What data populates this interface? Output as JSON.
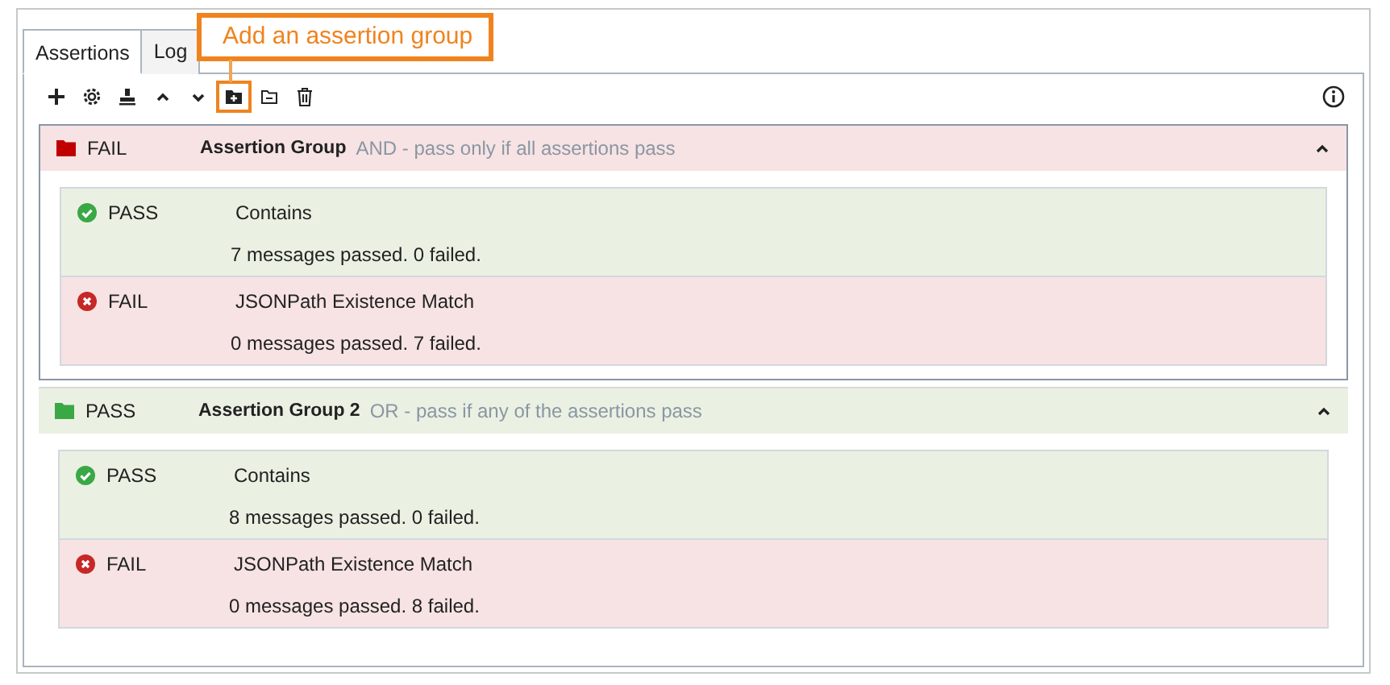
{
  "tabs": [
    {
      "label": "Assertions",
      "selected": true
    },
    {
      "label": "Log",
      "selected": false
    }
  ],
  "toolbar": [
    {
      "highlighted": false
    },
    {
      "highlighted": false
    },
    {
      "highlighted": false
    },
    {
      "highlighted": false
    },
    {
      "highlighted": false
    },
    {
      "highlighted": true
    },
    {
      "highlighted": false
    },
    {
      "highlighted": false
    }
  ],
  "callout": {
    "text": "Add an assertion group"
  },
  "groups": [
    {
      "status": "FAIL",
      "passed": false,
      "selected": true,
      "expanded": true,
      "name": "Assertion Group",
      "rule": "AND - pass only if all assertions pass",
      "assertions": [
        {
          "status": "PASS",
          "passed": true,
          "name": "Contains",
          "summary": "7 messages passed. 0 failed."
        },
        {
          "status": "FAIL",
          "passed": false,
          "name": "JSONPath Existence Match",
          "summary": "0 messages passed. 7 failed."
        }
      ]
    },
    {
      "status": "PASS",
      "passed": true,
      "selected": false,
      "expanded": true,
      "name": "Assertion Group 2",
      "rule": "OR - pass if any of the assertions pass",
      "assertions": [
        {
          "status": "PASS",
          "passed": true,
          "name": "Contains",
          "summary": "8 messages passed. 0 failed."
        },
        {
          "status": "FAIL",
          "passed": false,
          "name": "JSONPath Existence Match",
          "summary": "0 messages passed. 8 failed."
        }
      ]
    }
  ]
}
